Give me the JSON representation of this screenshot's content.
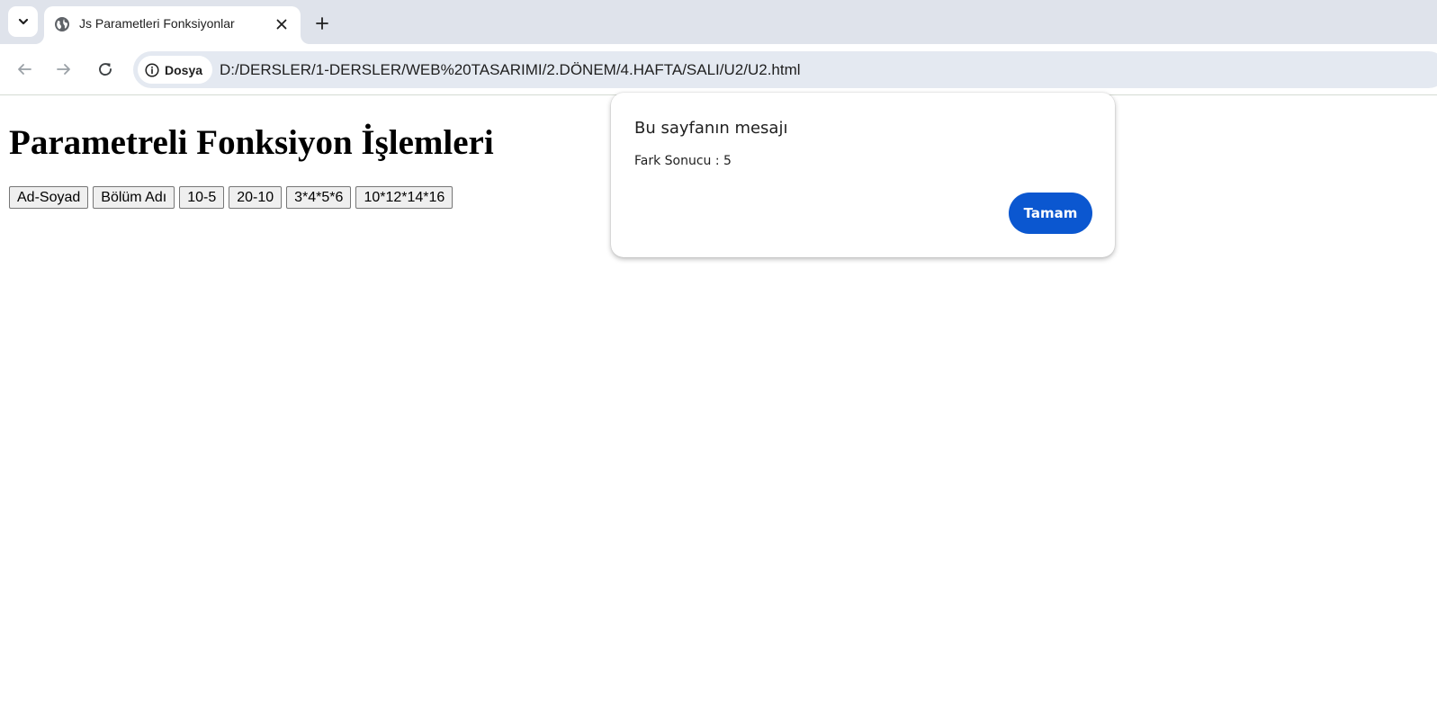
{
  "browser": {
    "tab": {
      "title": "Js Parametleri Fonksiyonlar",
      "favicon": "globe-icon"
    },
    "omnibox": {
      "site_chip_label": "Dosya",
      "url": "D:/DERSLER/1-DERSLER/WEB%20TASARIMI/2.DÖNEM/4.HAFTA/SALI/U2/U2.html"
    },
    "icons": {
      "tab_search": "chevron-down-icon",
      "tab_close": "close-icon",
      "new_tab": "plus-icon",
      "back": "arrow-left-icon",
      "forward": "arrow-right-icon",
      "reload": "reload-icon",
      "site_info": "info-icon"
    }
  },
  "page": {
    "heading": "Parametreli Fonksiyon İşlemleri",
    "buttons": [
      {
        "label": "Ad-Soyad"
      },
      {
        "label": "Bölüm Adı"
      },
      {
        "label": "10-5"
      },
      {
        "label": "20-10"
      },
      {
        "label": "3*4*5*6"
      },
      {
        "label": "10*12*14*16"
      }
    ]
  },
  "dialog": {
    "title": "Bu sayfanın mesajı",
    "message": "Fark Sonucu : 5",
    "ok_label": "Tamam",
    "accent_color": "#0b57d0"
  }
}
